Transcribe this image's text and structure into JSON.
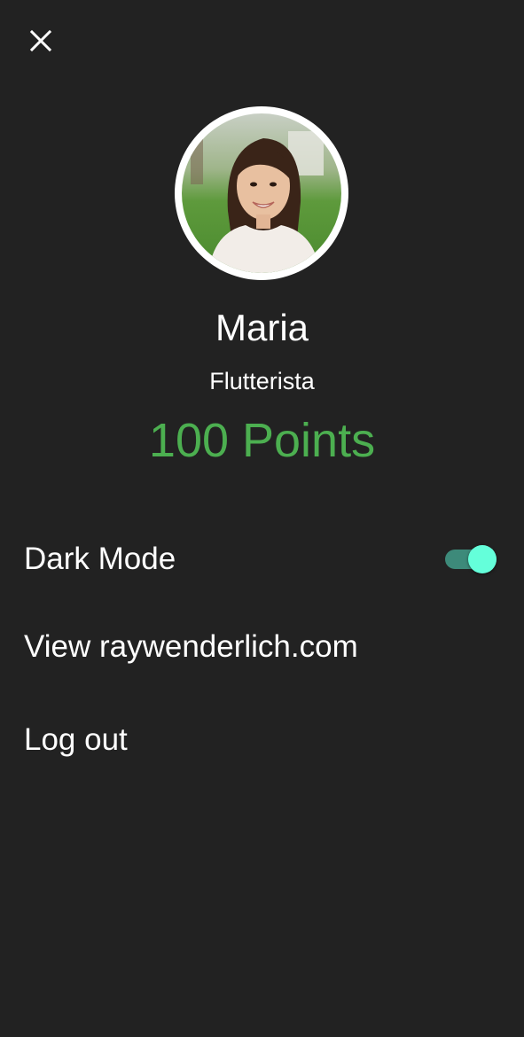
{
  "profile": {
    "name": "Maria",
    "title": "Flutterista",
    "points": "100 Points"
  },
  "settings": {
    "dark_mode_label": "Dark Mode",
    "dark_mode_on": true,
    "view_site_label": "View raywenderlich.com",
    "logout_label": "Log out"
  },
  "icons": {
    "close": "close-icon"
  },
  "colors": {
    "background": "#222222",
    "points": "#4caf50",
    "toggle_track": "#3d8a7a",
    "toggle_thumb": "#64ffda"
  }
}
